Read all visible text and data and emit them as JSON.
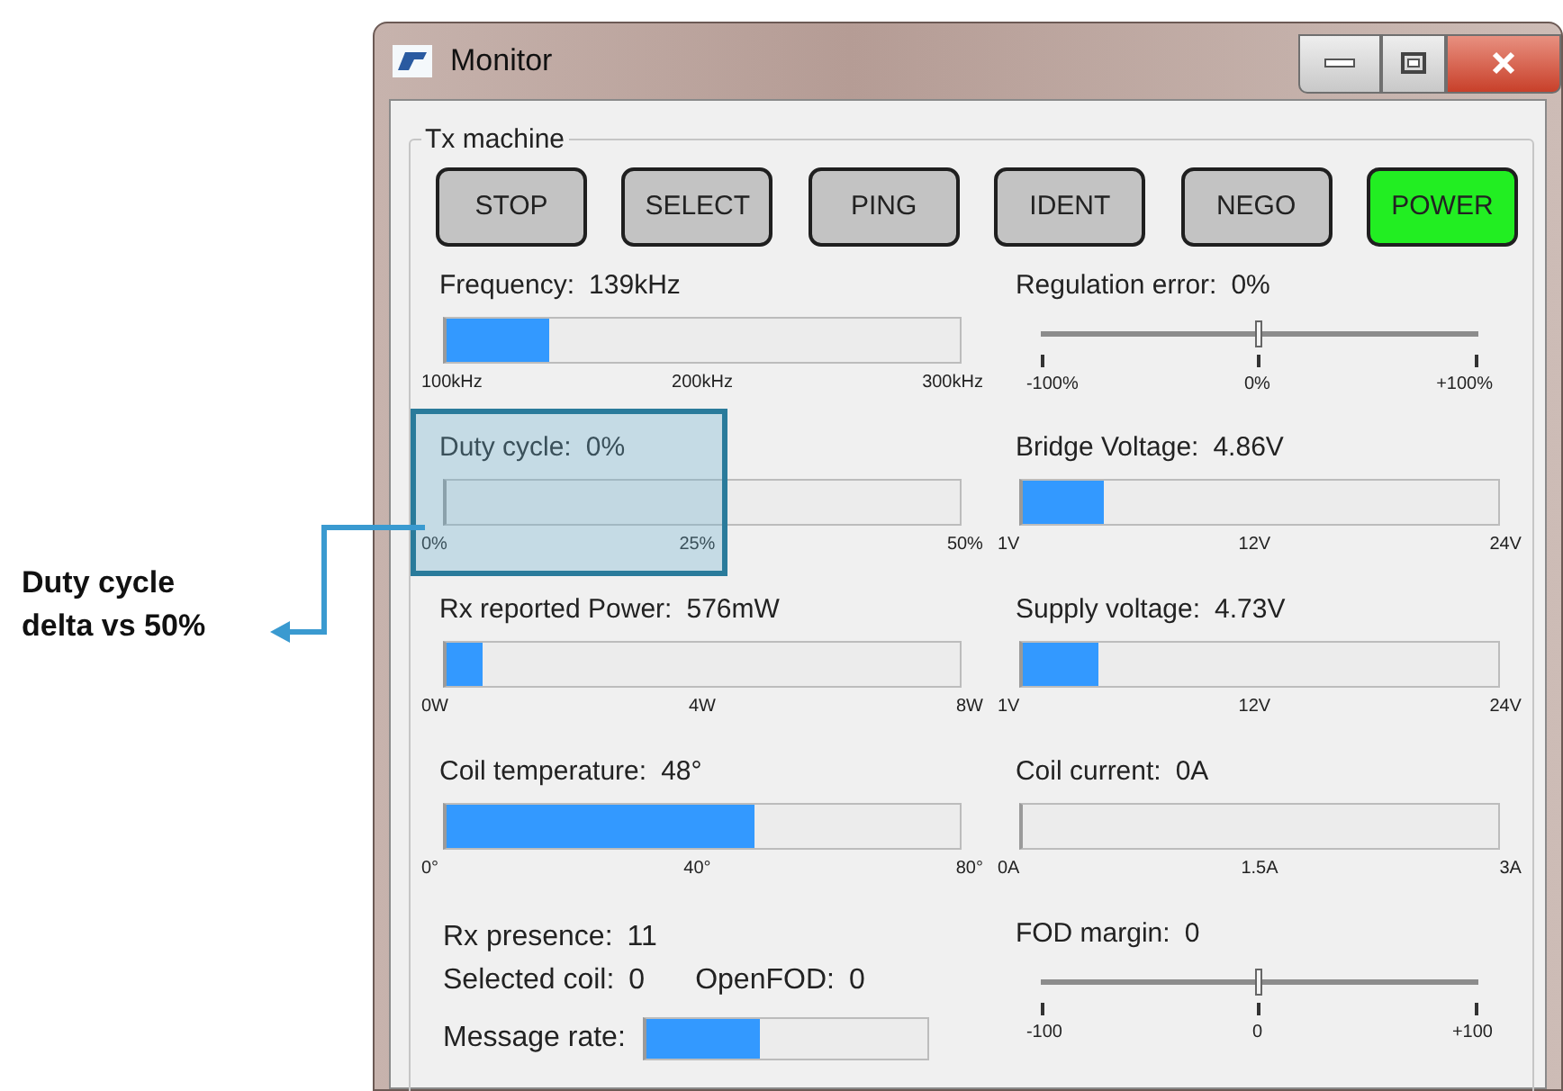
{
  "window": {
    "title": "Monitor"
  },
  "group": {
    "title": "Tx machine"
  },
  "buttons": [
    {
      "label": "STOP",
      "active": false
    },
    {
      "label": "SELECT",
      "active": false
    },
    {
      "label": "PING",
      "active": false
    },
    {
      "label": "IDENT",
      "active": false
    },
    {
      "label": "NEGO",
      "active": false
    },
    {
      "label": "POWER",
      "active": true
    }
  ],
  "left_meters": [
    {
      "kind": "bar",
      "label": "Frequency:",
      "reading": "139kHz",
      "level": 0.2,
      "ticks": [
        "100kHz",
        "200kHz",
        "300kHz"
      ],
      "highlighted": false
    },
    {
      "kind": "bar",
      "label": "Duty cycle:",
      "reading": "0%",
      "level": 0,
      "ticks": [
        "0%",
        "25%",
        "50%"
      ],
      "highlighted": true
    },
    {
      "kind": "bar",
      "label": "Rx reported Power:",
      "reading": "576mW",
      "level": 0.07,
      "ticks": [
        "0W",
        "4W",
        "8W"
      ],
      "highlighted": false
    },
    {
      "kind": "bar",
      "label": "Coil temperature:",
      "reading": "48°",
      "level": 0.6,
      "ticks": [
        "0°",
        "40°",
        "80°"
      ],
      "highlighted": false
    }
  ],
  "right_meters": [
    {
      "kind": "slider",
      "label": "Regulation error:",
      "reading": "0%",
      "level": 0.5,
      "ticks": [
        "-100%",
        "0%",
        "+100%"
      ]
    },
    {
      "kind": "bar",
      "label": "Bridge Voltage:",
      "reading": "4.86V",
      "level": 0.17,
      "ticks": [
        "1V",
        "12V",
        "24V"
      ]
    },
    {
      "kind": "bar",
      "label": "Supply voltage:",
      "reading": "4.73V",
      "level": 0.16,
      "ticks": [
        "1V",
        "12V",
        "24V"
      ]
    },
    {
      "kind": "bar",
      "label": "Coil current:",
      "reading": "0A",
      "level": 0,
      "ticks": [
        "0A",
        "1.5A",
        "3A"
      ]
    },
    {
      "kind": "slider",
      "label": "FOD margin:",
      "reading": "0",
      "level": 0.5,
      "ticks": [
        "-100",
        "0",
        "+100"
      ]
    }
  ],
  "status_lines": [
    [
      {
        "label": "Rx presence:",
        "value": "11"
      }
    ],
    [
      {
        "label": "Selected coil:",
        "value": "0"
      },
      {
        "label": "OpenFOD:",
        "value": "0"
      }
    ]
  ],
  "message_rate": {
    "label": "Message rate:",
    "level": 0.4
  },
  "annotation": {
    "text": "Duty cycle delta vs 50%"
  }
}
